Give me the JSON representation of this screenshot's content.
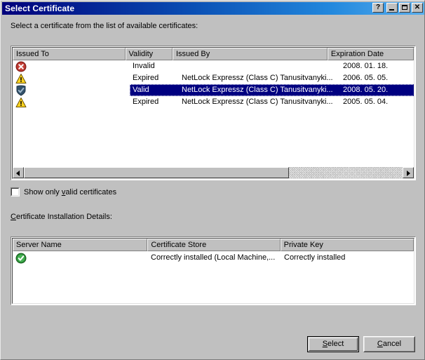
{
  "window": {
    "title": "Select Certificate",
    "buttons": [
      {
        "name": "help-button",
        "glyph": "?"
      },
      {
        "name": "minimize-button",
        "glyph": "minimize"
      },
      {
        "name": "maximize-button",
        "glyph": "maximize"
      },
      {
        "name": "close-button",
        "glyph": "✕"
      }
    ]
  },
  "prompt": "Select a certificate from the list of available certificates:",
  "certificate_list": {
    "columns": [
      "Issued To",
      "Validity",
      "Issued By",
      "Expiration Date"
    ],
    "rows": [
      {
        "icon": "error-icon",
        "issued_to": "",
        "validity": "Invalid",
        "issued_by": "",
        "expiration_date": "2008. 01. 18.",
        "selected": false
      },
      {
        "icon": "warning-icon",
        "issued_to": "",
        "validity": "Expired",
        "issued_by": "NetLock Expressz (Class C) Tanusitvanyki...",
        "expiration_date": "2006. 05. 05.",
        "selected": false
      },
      {
        "icon": "valid-shield-icon",
        "issued_to": "",
        "validity": "Valid",
        "issued_by": "NetLock Expressz (Class C) Tanusitvanyki...",
        "expiration_date": "2008. 05. 20.",
        "selected": true
      },
      {
        "icon": "warning-icon",
        "issued_to": "",
        "validity": "Expired",
        "issued_by": "NetLock Expressz (Class C) Tanusitvanyki...",
        "expiration_date": "2005. 05. 04.",
        "selected": false
      }
    ],
    "scrollbar": {
      "thumb_percent": 70
    }
  },
  "show_valid_checkbox": {
    "label_before": "Show only ",
    "accesskey": "v",
    "label_after": "alid certificates",
    "checked": false
  },
  "details_label": {
    "accesskey": "C",
    "text_after": "ertificate Installation Details:"
  },
  "details_list": {
    "columns": [
      "Server Name",
      "Certificate Store",
      "Private Key"
    ],
    "rows": [
      {
        "icon": "success-icon",
        "server_name": "",
        "certificate_store": "Correctly installed (Local Machine,...",
        "private_key": "Correctly installed"
      }
    ]
  },
  "footer": {
    "select_accesskey": "S",
    "select_after": "elect",
    "cancel_accesskey": "C",
    "cancel_after": "ancel"
  },
  "colors": {
    "dialog_face": "#c0c0c0",
    "titlebar_start": "#00007b",
    "titlebar_end": "#58aeee",
    "selection": "#000080",
    "error_red": "#c0392b",
    "warning_yellow": "#ffd320",
    "valid_blue": "#2f4f6f",
    "success_green": "#2a9b36"
  }
}
